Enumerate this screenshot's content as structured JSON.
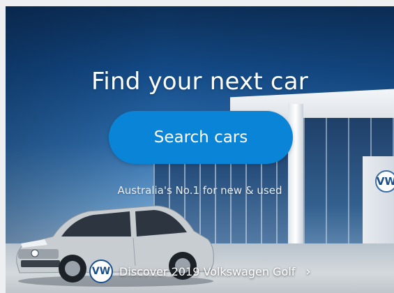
{
  "hero": {
    "headline": "Find your next car",
    "search_button_label": "Search cars",
    "tagline": "Australia's No.1 for new & used",
    "promo": {
      "badge_text": "VW",
      "label": "Discover 2019 Volkswagen Golf",
      "chevron": "›",
      "icon": "volkswagen-logo-icon"
    },
    "building_logo_text": "VW"
  },
  "colors": {
    "button": "#0a84d6",
    "page_background": "#eeeff1",
    "text": "#ffffff"
  }
}
